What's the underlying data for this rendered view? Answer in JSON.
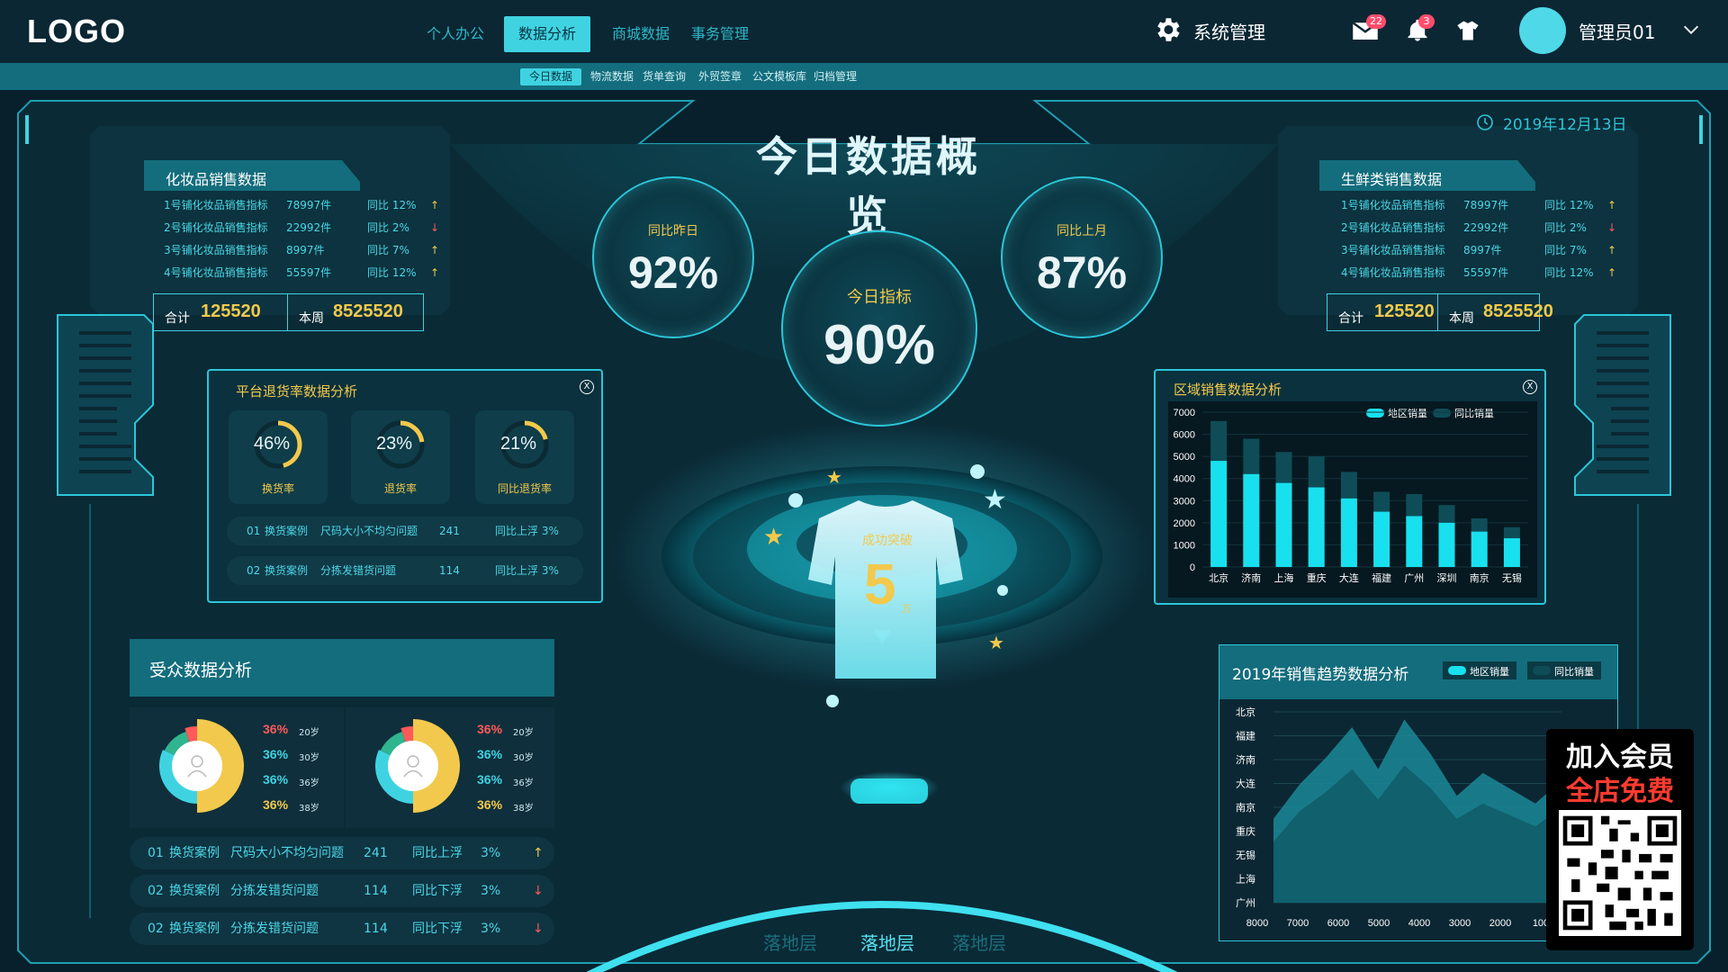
{
  "header": {
    "logo": "LOGO",
    "nav": [
      "个人办公",
      "数据分析",
      "商城数据",
      "事务管理"
    ],
    "nav_active_index": 1,
    "system": "系统管理",
    "mail_badge": "22",
    "bell_badge": "3",
    "user_name": "管理员01"
  },
  "subnav": [
    "今日数据",
    "物流数据",
    "货单查询",
    "外贸签章",
    "公文模板库",
    "归档管理"
  ],
  "date": "2019年12月13日",
  "title": "今日数据概览",
  "indicators": {
    "yesterday": {
      "label": "同比昨日",
      "value": "92%"
    },
    "today": {
      "label": "今日指标",
      "value": "90%"
    },
    "last_month": {
      "label": "同比上月",
      "value": "87%"
    }
  },
  "cosmetics": {
    "title": "化妆品销售数据",
    "rows": [
      {
        "name": "1号铺化妆品销售指标",
        "qty": "78997件",
        "cmp": "同比 12%",
        "trend": "↑"
      },
      {
        "name": "2号铺化妆品销售指标",
        "qty": "22992件",
        "cmp": "同比 2%",
        "trend": "↓"
      },
      {
        "name": "3号铺化妆品销售指标",
        "qty": "8997件",
        "cmp": "同比 7%",
        "trend": "↑"
      },
      {
        "name": "4号铺化妆品销售指标",
        "qty": "55597件",
        "cmp": "同比 12%",
        "trend": "↑"
      }
    ],
    "total_label": "合计",
    "total": "125520",
    "week_label": "本周",
    "week": "8525520"
  },
  "fresh": {
    "title": "生鲜类销售数据",
    "rows": [
      {
        "name": "1号铺化妆品销售指标",
        "qty": "78997件",
        "cmp": "同比 12%",
        "trend": "↑"
      },
      {
        "name": "2号铺化妆品销售指标",
        "qty": "22992件",
        "cmp": "同比 2%",
        "trend": "↓"
      },
      {
        "name": "3号铺化妆品销售指标",
        "qty": "8997件",
        "cmp": "同比 7%",
        "trend": "↑"
      },
      {
        "name": "4号铺化妆品销售指标",
        "qty": "55597件",
        "cmp": "同比 12%",
        "trend": "↑"
      }
    ],
    "total_label": "合计",
    "total": "125520",
    "week_label": "本周",
    "week": "8525520"
  },
  "returns": {
    "title": "平台退货率数据分析",
    "close": "X",
    "rings": [
      {
        "value": "46%",
        "label": "换货率",
        "fraction": 0.46
      },
      {
        "value": "23%",
        "label": "退货率",
        "fraction": 0.23
      },
      {
        "value": "21%",
        "label": "同比退货率",
        "fraction": 0.21
      }
    ],
    "rows": [
      {
        "idx": "01",
        "type": "换货案例",
        "desc": "尺码大小不均匀问题",
        "num": "241",
        "cmp": "同比上浮 3%"
      },
      {
        "idx": "02",
        "type": "换货案例",
        "desc": "分拣发错货问题",
        "num": "114",
        "cmp": "同比上浮 3%"
      }
    ]
  },
  "center": {
    "badge_text": "成功突破",
    "badge_number": "5",
    "badge_unit": "万"
  },
  "audience": {
    "title": "受众数据分析",
    "cards": [
      {
        "items": [
          {
            "pct": "36%",
            "age": "20岁"
          },
          {
            "pct": "36%",
            "age": "30岁"
          },
          {
            "pct": "36%",
            "age": "36岁"
          },
          {
            "pct": "36%",
            "age": "38岁"
          }
        ]
      },
      {
        "items": [
          {
            "pct": "36%",
            "age": "20岁"
          },
          {
            "pct": "36%",
            "age": "30岁"
          },
          {
            "pct": "36%",
            "age": "36岁"
          },
          {
            "pct": "36%",
            "age": "38岁"
          }
        ]
      }
    ],
    "rows": [
      {
        "idx": "01",
        "type": "换货案例",
        "desc": "尺码大小不均匀问题",
        "num": "241",
        "cmp": "同比上浮",
        "pct": "3%",
        "trend": "↑"
      },
      {
        "idx": "02",
        "type": "换货案例",
        "desc": "分拣发错货问题",
        "num": "114",
        "cmp": "同比下浮",
        "pct": "3%",
        "trend": "↓"
      },
      {
        "idx": "02",
        "type": "换货案例",
        "desc": "分拣发错货问题",
        "num": "114",
        "cmp": "同比下浮",
        "pct": "3%",
        "trend": "↓"
      }
    ]
  },
  "region": {
    "title": "区域销售数据分析",
    "close": "X",
    "legend": [
      "地区销量",
      "同比销量"
    ]
  },
  "trend": {
    "title": "2019年销售趋势数据分析",
    "legend": [
      "地区销量",
      "同比销量"
    ]
  },
  "floors": [
    "落地层",
    "落地层",
    "落地层"
  ],
  "promo": {
    "line1": "加入会员",
    "line2": "全店免费"
  },
  "colors": {
    "accent": "#3fd3e2",
    "gold": "#f2c94c",
    "down": "#ff5a5a",
    "bg": "#07202c"
  },
  "chart_data": [
    {
      "type": "bar",
      "title": "区域销售数据分析",
      "categories": [
        "北京",
        "济南",
        "上海",
        "重庆",
        "大连",
        "福建",
        "广州",
        "深圳",
        "南京",
        "无锡"
      ],
      "series": [
        {
          "name": "地区销量",
          "values": [
            4800,
            4200,
            3800,
            3600,
            3100,
            2500,
            2300,
            2000,
            1600,
            1300
          ]
        },
        {
          "name": "同比销量",
          "values": [
            6600,
            5800,
            5200,
            5000,
            4300,
            3400,
            3300,
            2800,
            2200,
            1800
          ]
        }
      ],
      "yticks": [
        0,
        1000,
        2000,
        3000,
        4000,
        5000,
        6000,
        7000
      ],
      "ylim": [
        0,
        7000
      ],
      "legend": "top-right"
    },
    {
      "type": "area",
      "title": "2019年销售趋势数据分析",
      "categories": [
        "北京",
        "福建",
        "济南",
        "大连",
        "南京",
        "重庆",
        "无锡",
        "上海",
        "广州"
      ],
      "xticks": [
        "8000",
        "7000",
        "6000",
        "5000",
        "4000",
        "3000",
        "2000",
        "100"
      ],
      "series": [
        {
          "name": "地区销量",
          "values": [
            2200,
            3100,
            3800,
            4600,
            3500,
            4800,
            3900,
            2800,
            3400,
            3000,
            2600,
            3200
          ]
        },
        {
          "name": "同比销量",
          "values": [
            1600,
            2400,
            2900,
            3500,
            2700,
            3600,
            3000,
            2200,
            2600,
            2300,
            2000,
            2500
          ]
        }
      ],
      "legend": "top-right"
    }
  ]
}
